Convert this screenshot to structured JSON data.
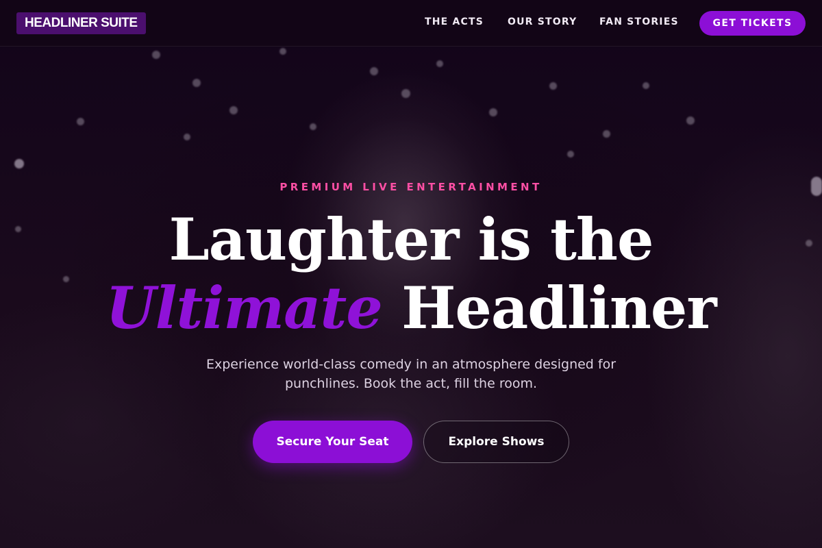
{
  "brand": {
    "name": "HEADLINER SUITE"
  },
  "nav": {
    "links": [
      "THE ACTS",
      "OUR STORY",
      "FAN STORIES"
    ],
    "cta_label": "GET TICKETS"
  },
  "hero": {
    "eyebrow": "PREMIUM LIVE ENTERTAINMENT",
    "headline_line1": "Laughter is the",
    "headline_accent": "Ultimate",
    "headline_line2_rest": "Headliner",
    "subtitle": "Experience world-class comedy in an atmosphere designed for punchlines. Book the act, fill the room.",
    "primary_button": "Secure Your Seat",
    "secondary_button": "Explore Shows"
  },
  "colors": {
    "accent_purple": "#8c0fd6",
    "eyebrow_pink": "#ff4fa5",
    "background": "#140616"
  }
}
